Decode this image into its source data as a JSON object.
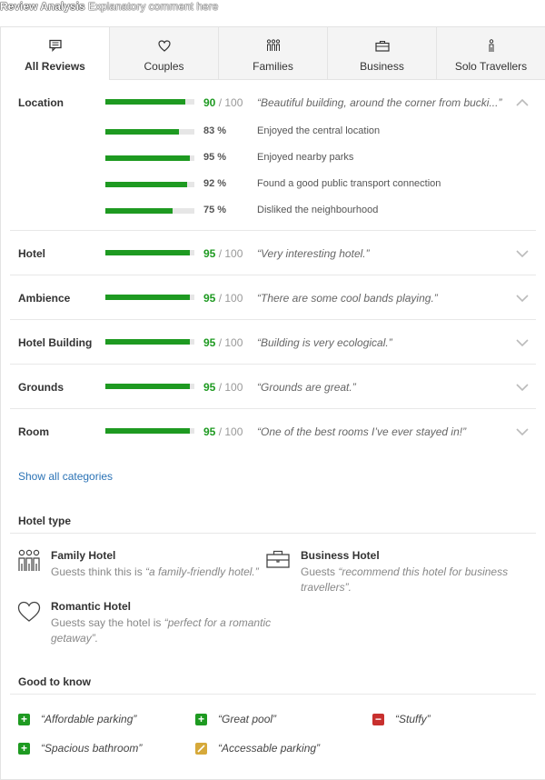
{
  "header": {
    "title": "Review Analysis",
    "comment": "Explanatory comment here"
  },
  "tabs": [
    {
      "label": "All Reviews",
      "icon": "review-list-icon",
      "active": true
    },
    {
      "label": "Couples",
      "icon": "heart-icon",
      "active": false
    },
    {
      "label": "Families",
      "icon": "family-icon",
      "active": false
    },
    {
      "label": "Business",
      "icon": "briefcase-icon",
      "active": false
    },
    {
      "label": "Solo Travellers",
      "icon": "person-icon",
      "active": false
    }
  ],
  "categories": [
    {
      "name": "Location",
      "score": "90",
      "max": "/ 100",
      "value": 90,
      "quote": "“Beautiful building, around the corner from bucki...”",
      "expanded": true
    },
    {
      "name": "Hotel",
      "score": "95",
      "max": "/ 100",
      "value": 95,
      "quote": "“Very interesting hotel.”",
      "expanded": false
    },
    {
      "name": "Ambience",
      "score": "95",
      "max": "/ 100",
      "value": 95,
      "quote": "“There are some cool bands playing.”",
      "expanded": false
    },
    {
      "name": "Hotel Building",
      "score": "95",
      "max": "/ 100",
      "value": 95,
      "quote": "“Building is very ecological.”",
      "expanded": false
    },
    {
      "name": "Grounds",
      "score": "95",
      "max": "/ 100",
      "value": 95,
      "quote": "“Grounds are great.”",
      "expanded": false
    },
    {
      "name": "Room",
      "score": "95",
      "max": "/ 100",
      "value": 95,
      "quote": "“One of the best rooms I’ve ever stayed in!”",
      "expanded": false
    }
  ],
  "location_details": [
    {
      "pct": "83 %",
      "value": 83,
      "text": "Enjoyed the central location"
    },
    {
      "pct": "95 %",
      "value": 95,
      "text": "Enjoyed nearby parks"
    },
    {
      "pct": "92 %",
      "value": 92,
      "text": "Found a good public transport connection"
    },
    {
      "pct": "75 %",
      "value": 75,
      "text": "Disliked the neighbourhood"
    }
  ],
  "show_all": "Show all categories",
  "hotel_type": {
    "title": "Hotel type",
    "items": [
      {
        "title": "Family Hotel",
        "icon": "family-icon",
        "desc_prefix": "Guests think this is ",
        "desc_quote": "“a family-friendly hotel.”",
        "desc_line2": ""
      },
      {
        "title": "Business Hotel",
        "icon": "briefcase-icon",
        "desc_prefix": "Guests ",
        "desc_quote": "“recommend this hotel for business",
        "desc_line2": "travellers”."
      },
      {
        "title": "Romantic Hotel",
        "icon": "heart-icon",
        "desc_prefix": "Guests say the hotel is ",
        "desc_quote": "“perfect for a romantic",
        "desc_line2": "getaway”."
      }
    ]
  },
  "good_to_know": {
    "title": "Good to know",
    "items": [
      {
        "text": "“Affordable parking”",
        "type": "positive"
      },
      {
        "text": "“Great pool”",
        "type": "positive"
      },
      {
        "text": "“Stuffy”",
        "type": "negative"
      },
      {
        "text": "“Spacious bathroom”",
        "type": "positive"
      },
      {
        "text": "“Accessable parking”",
        "type": "neutral"
      }
    ]
  },
  "colors": {
    "accent_green": "#1e9a21",
    "negative_red": "#c8302e",
    "neutral_yellow": "#d6a93a",
    "link_blue": "#2a72b5"
  }
}
